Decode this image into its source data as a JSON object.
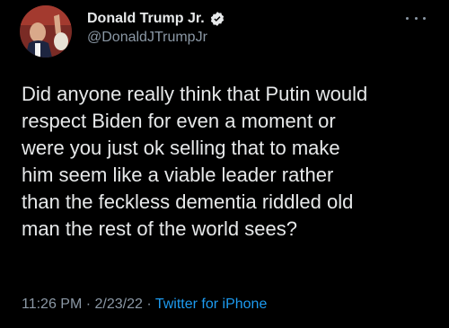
{
  "author": {
    "display_name": "Donald Trump Jr.",
    "handle": "@DonaldJTrumpJr",
    "verified": true
  },
  "icons": {
    "verified": "verified-badge-icon",
    "more": "more-horizontal-icon"
  },
  "tweet": {
    "lines": [
      "Did anyone really think that Putin would",
      "respect Biden for even a moment or",
      "were you just ok selling that to make",
      "him seem like a viable leader rather",
      "than the feckless dementia riddled old",
      "man the rest of the world sees?"
    ]
  },
  "meta": {
    "time": "11:26 PM",
    "separator1": " · ",
    "date": "2/23/22",
    "separator2": " · ",
    "source": "Twitter for iPhone"
  },
  "colors": {
    "background": "#000000",
    "text": "#e7e9ea",
    "secondary": "#8b98a5",
    "link": "#1d9bf0"
  }
}
